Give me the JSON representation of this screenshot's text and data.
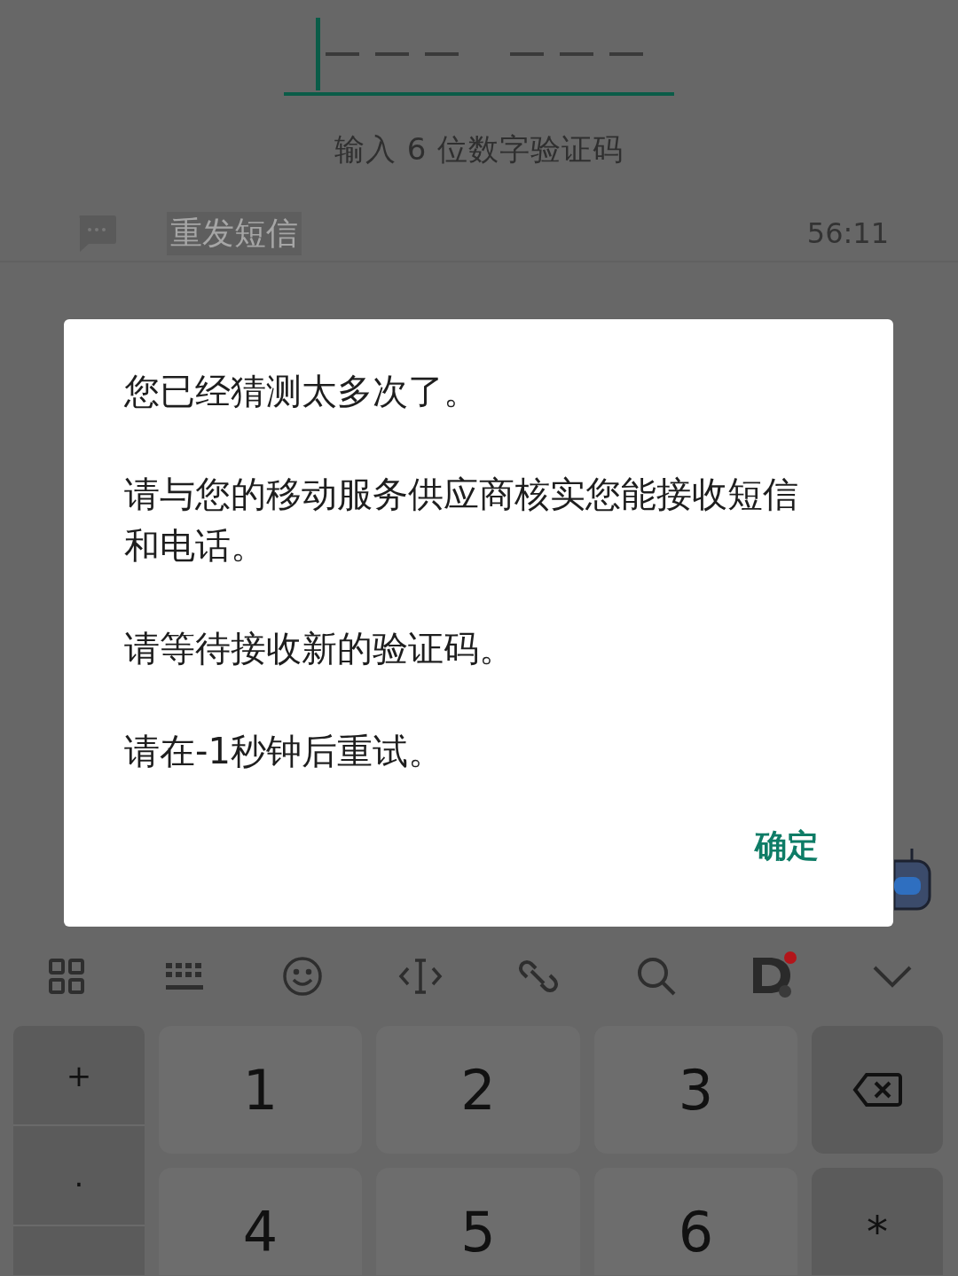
{
  "code_field": {
    "caption": "输入 6 位数字验证码",
    "focused": true
  },
  "resend": {
    "label": "重发短信",
    "timer": "56:11",
    "disabled": true
  },
  "dialog": {
    "paragraphs": [
      "您已经猜测太多次了。",
      "请与您的移动服务供应商核实您能接收短信和电话。",
      "请等待接收新的验证码。",
      "请在-1秒钟后重试。"
    ],
    "button": "确定"
  },
  "toolbar": {
    "notification": true
  },
  "keypad": {
    "side_keys": [
      "+",
      "."
    ],
    "keys": [
      {
        "kind": "digit",
        "label": "1"
      },
      {
        "kind": "digit",
        "label": "2"
      },
      {
        "kind": "digit",
        "label": "3"
      },
      {
        "kind": "backspace"
      },
      {
        "kind": "digit",
        "label": "4"
      },
      {
        "kind": "digit",
        "label": "5"
      },
      {
        "kind": "digit",
        "label": "6"
      },
      {
        "kind": "symbol",
        "label": "*"
      }
    ]
  }
}
